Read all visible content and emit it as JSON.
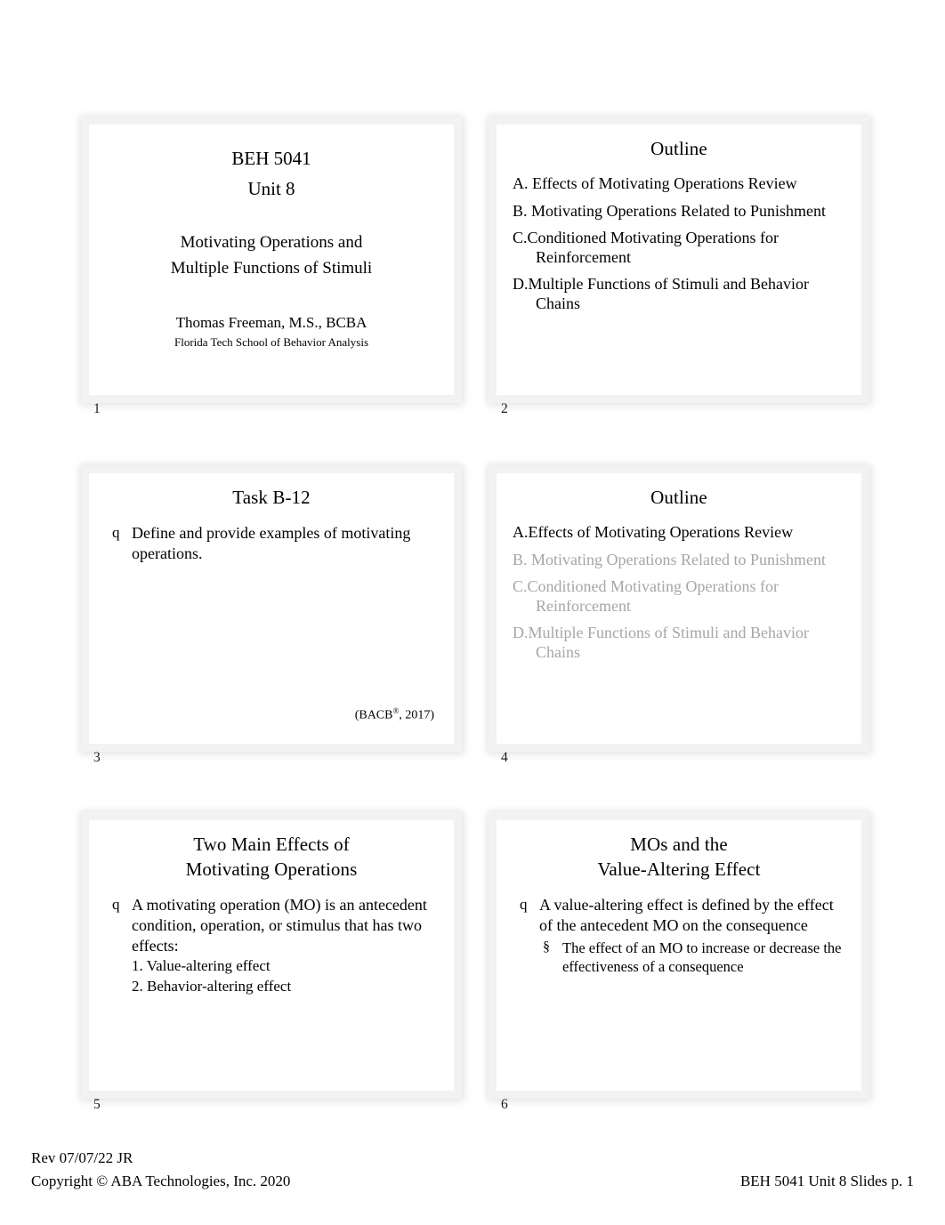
{
  "document": {
    "page_label": "BEH 5041 Unit 8 Slides p. 1"
  },
  "slides": [
    {
      "number": "1",
      "kind": "title",
      "title_lines": [
        "BEH 5041",
        "Unit 8"
      ],
      "subtitle_lines": [
        "Motivating Operations and",
        "Multiple Functions of Stimuli"
      ],
      "author": "Thomas Freeman, M.S., BCBA",
      "affiliation": "Florida Tech School of Behavior Analysis"
    },
    {
      "number": "2",
      "kind": "outline",
      "title_lines": [
        "Outline"
      ],
      "items": [
        {
          "label": "A. Effects of Motivating Operations Review",
          "dim": false
        },
        {
          "label": "B. Motivating Operations Related to Punishment",
          "dim": false
        },
        {
          "label": "C.Conditioned Motivating Operations for Reinforcement",
          "dim": false
        },
        {
          "label": "D.Multiple Functions of Stimuli and Behavior Chains",
          "dim": false
        }
      ]
    },
    {
      "number": "3",
      "kind": "bullets",
      "title_lines": [
        "Task B-12"
      ],
      "bullet_marker": "q",
      "bullets": [
        {
          "text": "Define and provide examples of motivating operations."
        }
      ],
      "citation": "(BACB",
      "citation_sup": "®",
      "citation_tail": ", 2017)"
    },
    {
      "number": "4",
      "kind": "outline",
      "title_lines": [
        "Outline"
      ],
      "items": [
        {
          "label": "A.Effects of Motivating Operations Review",
          "dim": false
        },
        {
          "label": "B. Motivating Operations Related to Punishment",
          "dim": true
        },
        {
          "label": "C.Conditioned Motivating Operations for Reinforcement",
          "dim": true
        },
        {
          "label": "D.Multiple Functions of Stimuli and Behavior Chains",
          "dim": true
        }
      ]
    },
    {
      "number": "5",
      "kind": "bullets",
      "title_lines": [
        "Two Main Effects of",
        "Motivating Operations"
      ],
      "bullet_marker": "q",
      "bullets": [
        {
          "text": "A motivating operation (MO) is an antecedent condition, operation, or stimulus that has two effects:"
        }
      ],
      "numbered": [
        "1. Value-altering effect",
        "2. Behavior-altering effect"
      ]
    },
    {
      "number": "6",
      "kind": "bullets",
      "title_lines": [
        "MOs and the",
        "Value-Altering Effect"
      ],
      "bullet_marker": "q",
      "sub_marker": "§",
      "bullets": [
        {
          "text": "A value-altering effect is defined by the effect of the antecedent MO on the consequence"
        }
      ],
      "sub_bullets": [
        "The effect of an MO to increase or decrease the effectiveness of a consequence"
      ]
    }
  ],
  "footer": {
    "revision": "Rev 07/07/22 JR",
    "copyright": "Copyright © ABA Technologies, Inc. 2020",
    "page_label": "BEH 5041 Unit 8 Slides p. 1"
  },
  "colors": {
    "text": "#000000",
    "dim_text": "#a6a6a6",
    "slide_frame": "#f2f2f2",
    "page_background": "#ffffff"
  }
}
